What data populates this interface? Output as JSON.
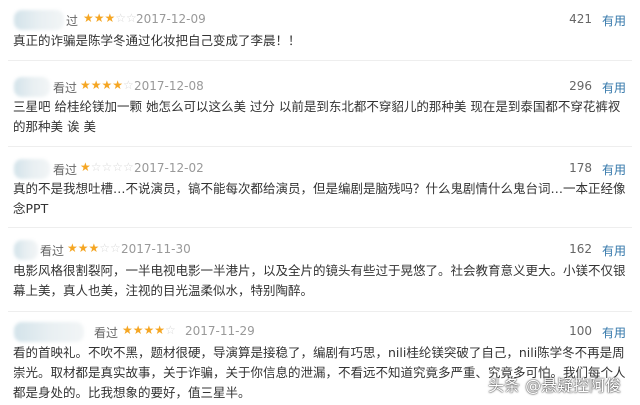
{
  "reviews": [
    {
      "status": "过",
      "stars_on": "★★★",
      "stars_off": "☆☆",
      "rating": 3,
      "date": "2017-12-09",
      "votes": "421",
      "useful": "有用",
      "text": "真正的诈骗是陈学冬通过化妆把自己变成了李晨！！"
    },
    {
      "status": "看过",
      "stars_on": "★★★★",
      "stars_off": "☆",
      "rating": 4,
      "date": "2017-12-08",
      "votes": "296",
      "useful": "有用",
      "text": "三星吧 给桂纶镁加一颗 她怎么可以这么美 过分 以前是到东北都不穿貂儿的那种美 现在是到泰国都不穿花裤衩的那种美 诶 美"
    },
    {
      "status": "看过",
      "stars_on": "★",
      "stars_off": "☆☆☆☆",
      "rating": 1,
      "date": "2017-12-02",
      "votes": "178",
      "useful": "有用",
      "text": "真的不是我想吐槽…不说演员，镐不能每次都给演员，但是编剧是脑残吗？什么鬼剧情什么鬼台词…一本正经像念PPT"
    },
    {
      "status": "看过",
      "stars_on": "★★★",
      "stars_off": "☆☆",
      "rating": 3,
      "date": "2017-11-30",
      "votes": "162",
      "useful": "有用",
      "text": "电影风格很割裂阿，一半电视电影一半港片，以及全片的镜头有些过于晃悠了。社会教育意义更大。小镁不仅银幕上美，真人也美，注视的目光温柔似水，特别陶醉。"
    },
    {
      "status": "看过",
      "stars_on": "★★★★",
      "stars_off": "☆",
      "rating": 4,
      "date": "2017-11-29",
      "votes": "100",
      "useful": "有用",
      "text": "看的首映礼。不吹不黑，题材很硬，导演算是接稳了，编剧有巧思，nili桂纶镁突破了自己，nili陈学冬不再是周崇光。取材都是真实故事，关于诈骗，关于你信息的泄漏，不看远不知道究竟多严重、究竟多可怕。我们每个人都是身处的。比我想象的要好，值三星半。"
    }
  ],
  "watermark": "头条 @悬疑控阿俊"
}
